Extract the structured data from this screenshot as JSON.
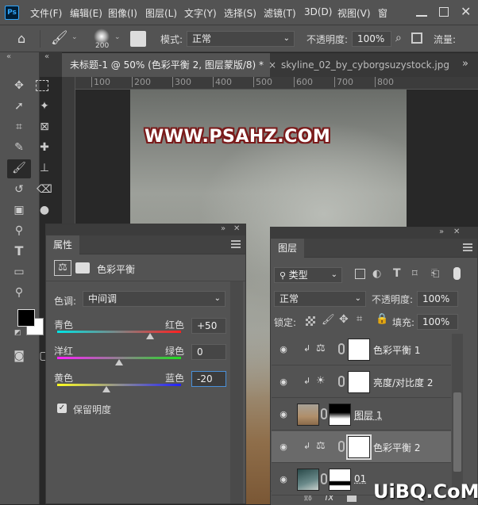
{
  "app": {
    "logo": "Ps"
  },
  "menu": [
    "文件(F)",
    "编辑(E)",
    "图像(I)",
    "图层(L)",
    "文字(Y)",
    "选择(S)",
    "滤镜(T)",
    "3D(D)",
    "视图(V)",
    "窗"
  ],
  "options": {
    "brush_size": "200",
    "mode_label": "模式:",
    "mode_value": "正常",
    "opacity_label": "不透明度:",
    "opacity_value": "100%",
    "flow_label": "流量:"
  },
  "tabs": [
    {
      "label": "未标题-1 @ 50% (色彩平衡 2, 图层蒙版/8) *",
      "active": true
    },
    {
      "label": "skyline_02_by_cyborgsuzystock.jpg",
      "active": false
    }
  ],
  "ruler": {
    "ticks": [
      "100",
      "200",
      "300",
      "400",
      "500",
      "600",
      "700",
      "800"
    ]
  },
  "canvas": {
    "watermark": "WWW.PSAHZ.COM"
  },
  "properties": {
    "tab": "属性",
    "title": "色彩平衡",
    "tone_label": "色调:",
    "tone_value": "中间调",
    "sliders": [
      {
        "left": "青色",
        "right": "红色",
        "value": "+50",
        "fraction": 0.75,
        "gradient": "linear-gradient(90deg,#00e5e5,#ff2020)"
      },
      {
        "left": "洋红",
        "right": "绿色",
        "value": "0",
        "fraction": 0.5,
        "gradient": "linear-gradient(90deg,#ff20ff,#20e020)"
      },
      {
        "left": "黄色",
        "right": "蓝色",
        "value": "-20",
        "fraction": 0.4,
        "gradient": "linear-gradient(90deg,#ffff20,#2020ff)"
      }
    ],
    "preserve_label": "保留明度"
  },
  "layers": {
    "tab": "图层",
    "filter_value": "类型",
    "blend_value": "正常",
    "opacity_label": "不透明度:",
    "opacity_value": "100%",
    "lock_label": "锁定:",
    "fill_label": "填充:",
    "fill_value": "100%",
    "rows": [
      {
        "name": "色彩平衡 1",
        "type": "balance",
        "selected": false
      },
      {
        "name": "亮度/对比度 2",
        "type": "brightness",
        "selected": false
      },
      {
        "name": "图层 1",
        "type": "image",
        "selected": false
      },
      {
        "name": "色彩平衡 2",
        "type": "balance",
        "selected": true
      },
      {
        "name": "01",
        "type": "image2",
        "selected": false
      }
    ],
    "footer_fx": "fx"
  },
  "branding": {
    "corner": "UiBQ.CoM"
  }
}
